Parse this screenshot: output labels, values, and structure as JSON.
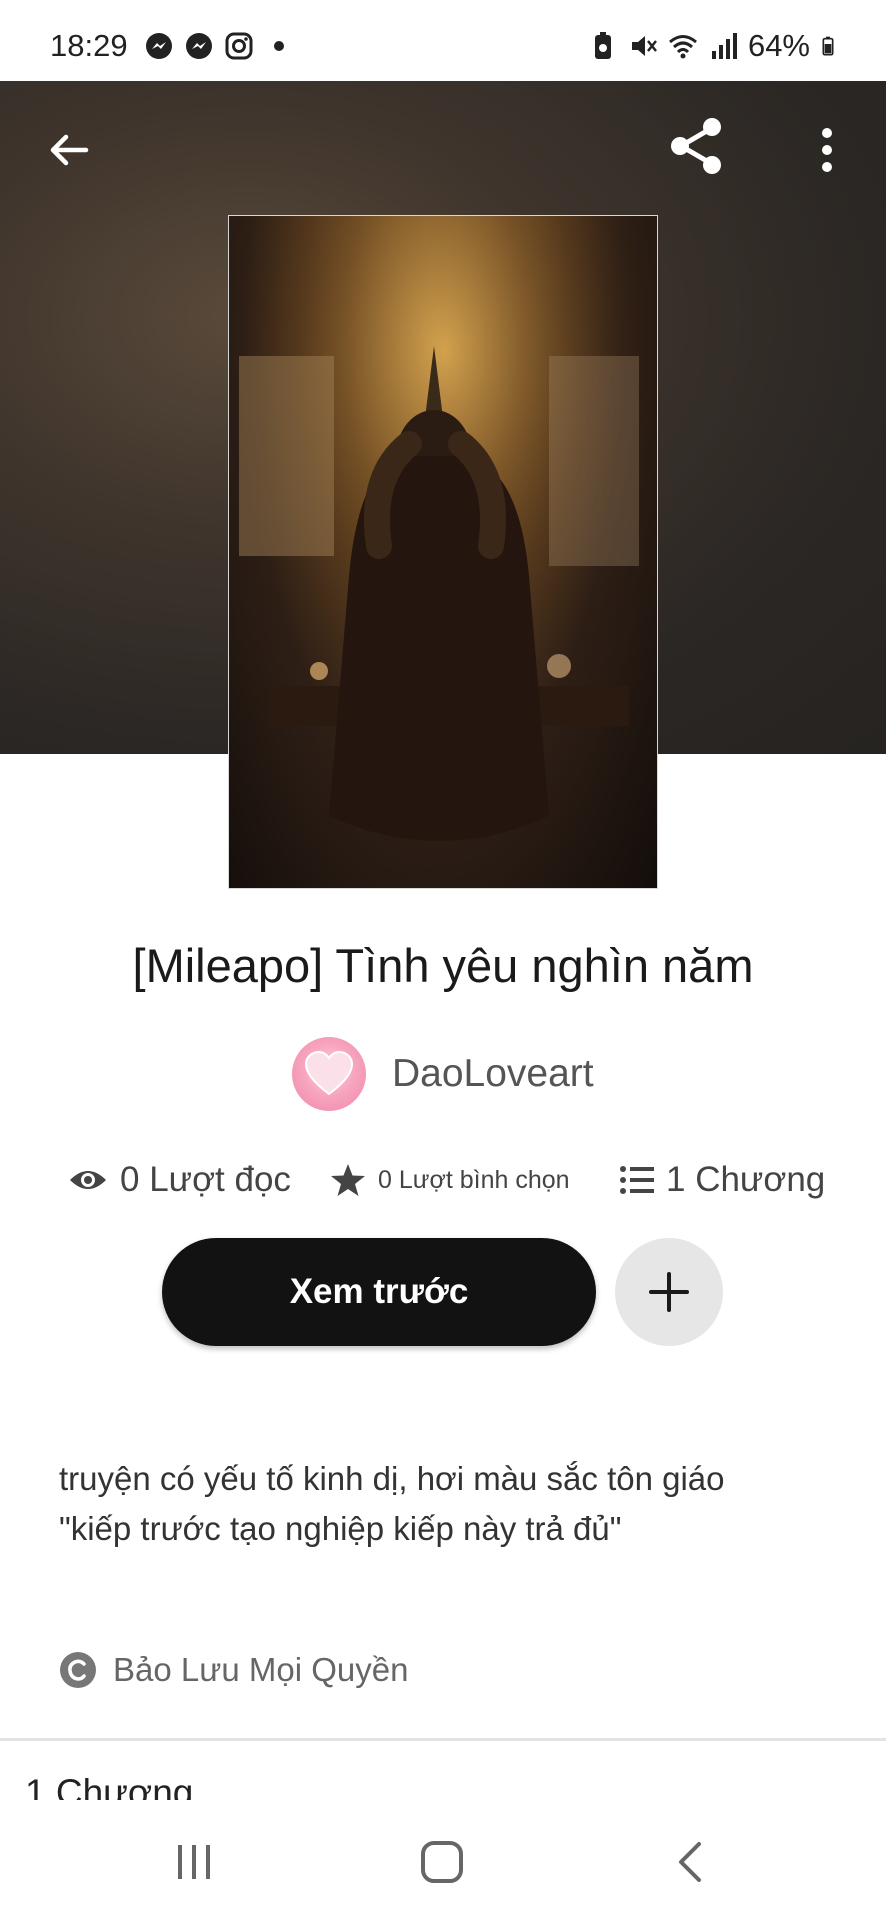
{
  "status_bar": {
    "time": "18:29",
    "battery_percent": "64%",
    "left_icons": [
      "messenger-icon",
      "messenger-icon",
      "instagram-icon",
      "dot-icon"
    ],
    "right_icons": [
      "battery-saver-icon",
      "mute-icon",
      "wifi-icon",
      "signal-icon",
      "battery-icon"
    ]
  },
  "header": {
    "back_icon": "arrow-left-icon",
    "share_icon": "share-icon",
    "more_icon": "more-vertical-icon"
  },
  "story": {
    "title": "[Mileapo] Tình yêu nghìn năm",
    "author": "DaoLoveart",
    "stats": {
      "reads": "0 Lượt đọc",
      "votes": "0 Lượt bình chọn",
      "parts": "1 Chương"
    },
    "description_line1": "truyện có yếu tố kinh dị, hơi  màu sắc tôn giáo",
    "description_line2": "\"kiếp trước tạo nghiệp kiếp này trả đủ\"",
    "copyright": "Bảo Lưu Mọi Quyền",
    "parts_header": "1 Chương"
  },
  "actions": {
    "preview_label": "Xem trước",
    "add_icon": "plus-icon"
  },
  "nav": {
    "recents_icon": "recents-icon",
    "home_icon": "home-icon",
    "back_icon": "back-chevron-icon"
  },
  "colors": {
    "primary_button": "#121212",
    "secondary_button": "#e6e6e6",
    "hero_background": "#2b2724"
  }
}
